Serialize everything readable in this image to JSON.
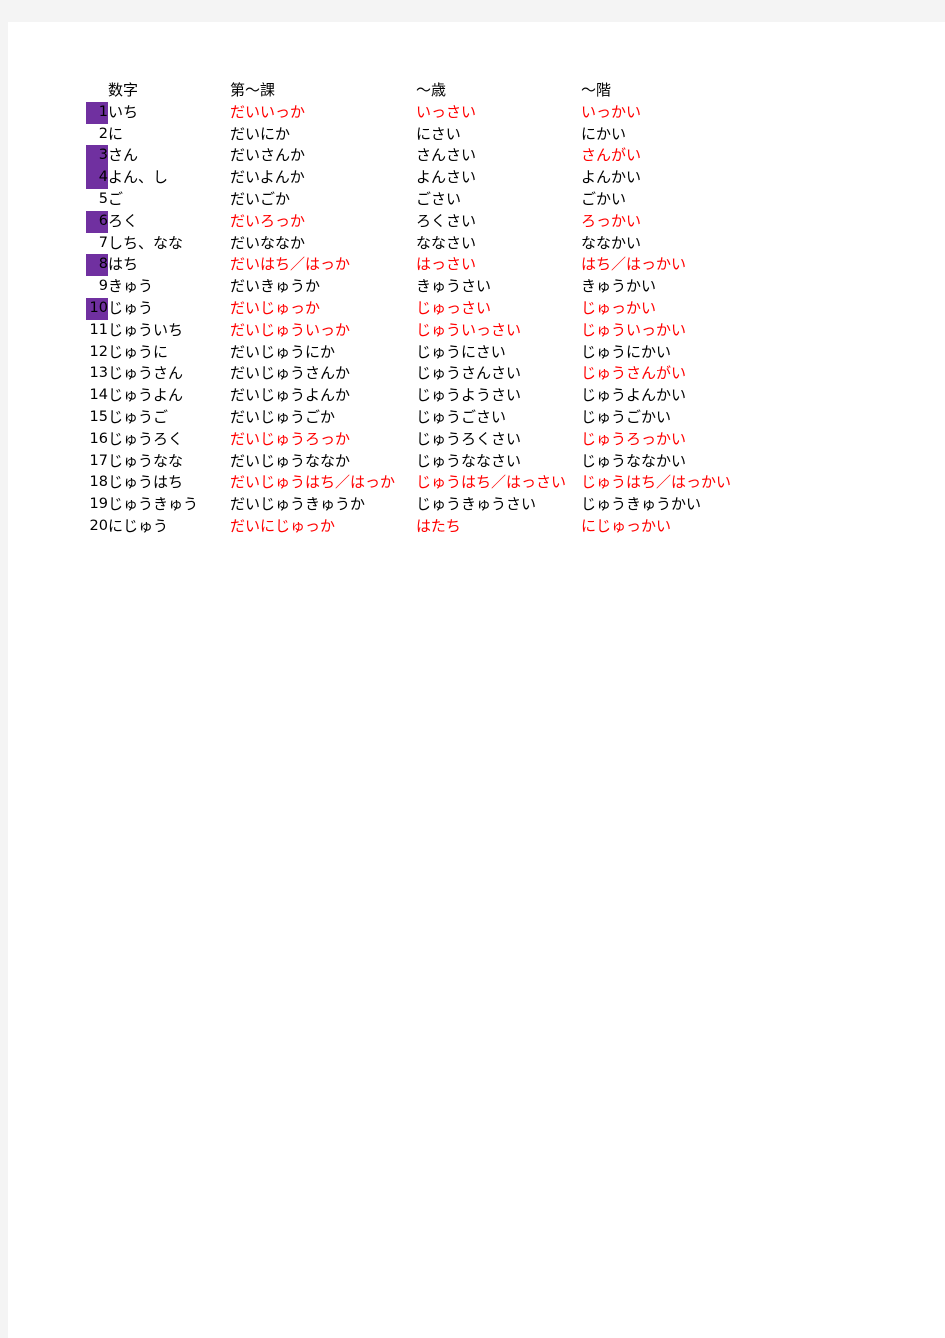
{
  "document": {
    "colors": {
      "highlight": "#7030a0",
      "emphasis": "#ff0000",
      "text": "#000000",
      "page": "#ffffff",
      "backdrop": "#f4f4f4"
    }
  },
  "table": {
    "headers": {
      "number": "数字",
      "lesson": "第～課",
      "age": "～歳",
      "floor": "～階"
    },
    "rows": [
      {
        "n": "1",
        "hl": true,
        "kana": "いち",
        "kana_red": false,
        "lesson": "だいいっか",
        "lesson_red": true,
        "age": "いっさい",
        "age_red": true,
        "floor": "いっかい",
        "floor_red": true
      },
      {
        "n": "2",
        "hl": false,
        "kana": "に",
        "kana_red": false,
        "lesson": "だいにか",
        "lesson_red": false,
        "age": "にさい",
        "age_red": false,
        "floor": "にかい",
        "floor_red": false
      },
      {
        "n": "3",
        "hl": true,
        "kana": "さん",
        "kana_red": false,
        "lesson": "だいさんか",
        "lesson_red": false,
        "age": "さんさい",
        "age_red": false,
        "floor": "さんがい",
        "floor_red": true
      },
      {
        "n": "4",
        "hl": true,
        "kana": "よん、し",
        "kana_red": false,
        "lesson": "だいよんか",
        "lesson_red": false,
        "age": "よんさい",
        "age_red": false,
        "floor": "よんかい",
        "floor_red": false
      },
      {
        "n": "5",
        "hl": false,
        "kana": "ご",
        "kana_red": false,
        "lesson": "だいごか",
        "lesson_red": false,
        "age": "ごさい",
        "age_red": false,
        "floor": "ごかい",
        "floor_red": false
      },
      {
        "n": "6",
        "hl": true,
        "kana": "ろく",
        "kana_red": false,
        "lesson": "だいろっか",
        "lesson_red": true,
        "age": "ろくさい",
        "age_red": false,
        "floor": "ろっかい",
        "floor_red": true
      },
      {
        "n": "7",
        "hl": false,
        "kana": "しち、なな",
        "kana_red": false,
        "lesson": "だいななか",
        "lesson_red": false,
        "age": "ななさい",
        "age_red": false,
        "floor": "ななかい",
        "floor_red": false
      },
      {
        "n": "8",
        "hl": true,
        "kana": "はち",
        "kana_red": false,
        "lesson": "だいはち／はっか",
        "lesson_red": true,
        "age": "はっさい",
        "age_red": true,
        "floor": "はち／はっかい",
        "floor_red": true
      },
      {
        "n": "9",
        "hl": false,
        "kana": "きゅう",
        "kana_red": false,
        "lesson": "だいきゅうか",
        "lesson_red": false,
        "age": "きゅうさい",
        "age_red": false,
        "floor": "きゅうかい",
        "floor_red": false
      },
      {
        "n": "10",
        "hl": true,
        "kana": "じゅう",
        "kana_red": false,
        "lesson": "だいじゅっか",
        "lesson_red": true,
        "age": "じゅっさい",
        "age_red": true,
        "floor": "じゅっかい",
        "floor_red": true
      },
      {
        "n": "11",
        "hl": false,
        "kana": "じゅういち",
        "kana_red": false,
        "lesson": "だいじゅういっか",
        "lesson_red": true,
        "age": "じゅういっさい",
        "age_red": true,
        "floor": "じゅういっかい",
        "floor_red": true
      },
      {
        "n": "12",
        "hl": false,
        "kana": "じゅうに",
        "kana_red": false,
        "lesson": "だいじゅうにか",
        "lesson_red": false,
        "age": "じゅうにさい",
        "age_red": false,
        "floor": "じゅうにかい",
        "floor_red": false
      },
      {
        "n": "13",
        "hl": false,
        "kana": "じゅうさん",
        "kana_red": false,
        "lesson": "だいじゅうさんか",
        "lesson_red": false,
        "age": "じゅうさんさい",
        "age_red": false,
        "floor": "じゅうさんがい",
        "floor_red": true
      },
      {
        "n": "14",
        "hl": false,
        "kana": "じゅうよん",
        "kana_red": false,
        "lesson": "だいじゅうよんか",
        "lesson_red": false,
        "age": "じゅうようさい",
        "age_red": false,
        "floor": "じゅうよんかい",
        "floor_red": false
      },
      {
        "n": "15",
        "hl": false,
        "kana": "じゅうご",
        "kana_red": false,
        "lesson": "だいじゅうごか",
        "lesson_red": false,
        "age": "じゅうごさい",
        "age_red": false,
        "floor": "じゅうごかい",
        "floor_red": false
      },
      {
        "n": "16",
        "hl": false,
        "kana": "じゅうろく",
        "kana_red": false,
        "lesson": "だいじゅうろっか",
        "lesson_red": true,
        "age": "じゅうろくさい",
        "age_red": false,
        "floor": "じゅうろっかい",
        "floor_red": true
      },
      {
        "n": "17",
        "hl": false,
        "kana": "じゅうなな",
        "kana_red": false,
        "lesson": "だいじゅうななか",
        "lesson_red": false,
        "age": "じゅうななさい",
        "age_red": false,
        "floor": "じゅうななかい",
        "floor_red": false
      },
      {
        "n": "18",
        "hl": false,
        "kana": "じゅうはち",
        "kana_red": false,
        "lesson": "だいじゅうはち／はっか",
        "lesson_red": true,
        "age": "じゅうはち／はっさい",
        "age_red": true,
        "floor": "じゅうはち／はっかい",
        "floor_red": true
      },
      {
        "n": "19",
        "hl": false,
        "kana": "じゅうきゅう",
        "kana_red": false,
        "lesson": "だいじゅうきゅうか",
        "lesson_red": false,
        "age": "じゅうきゅうさい",
        "age_red": false,
        "floor": "じゅうきゅうかい",
        "floor_red": false
      },
      {
        "n": "20",
        "hl": false,
        "kana": "にじゅう",
        "kana_red": false,
        "lesson": "だいにじゅっか",
        "lesson_red": true,
        "age": "はたち",
        "age_red": true,
        "floor": "にじゅっかい",
        "floor_red": true
      }
    ]
  }
}
